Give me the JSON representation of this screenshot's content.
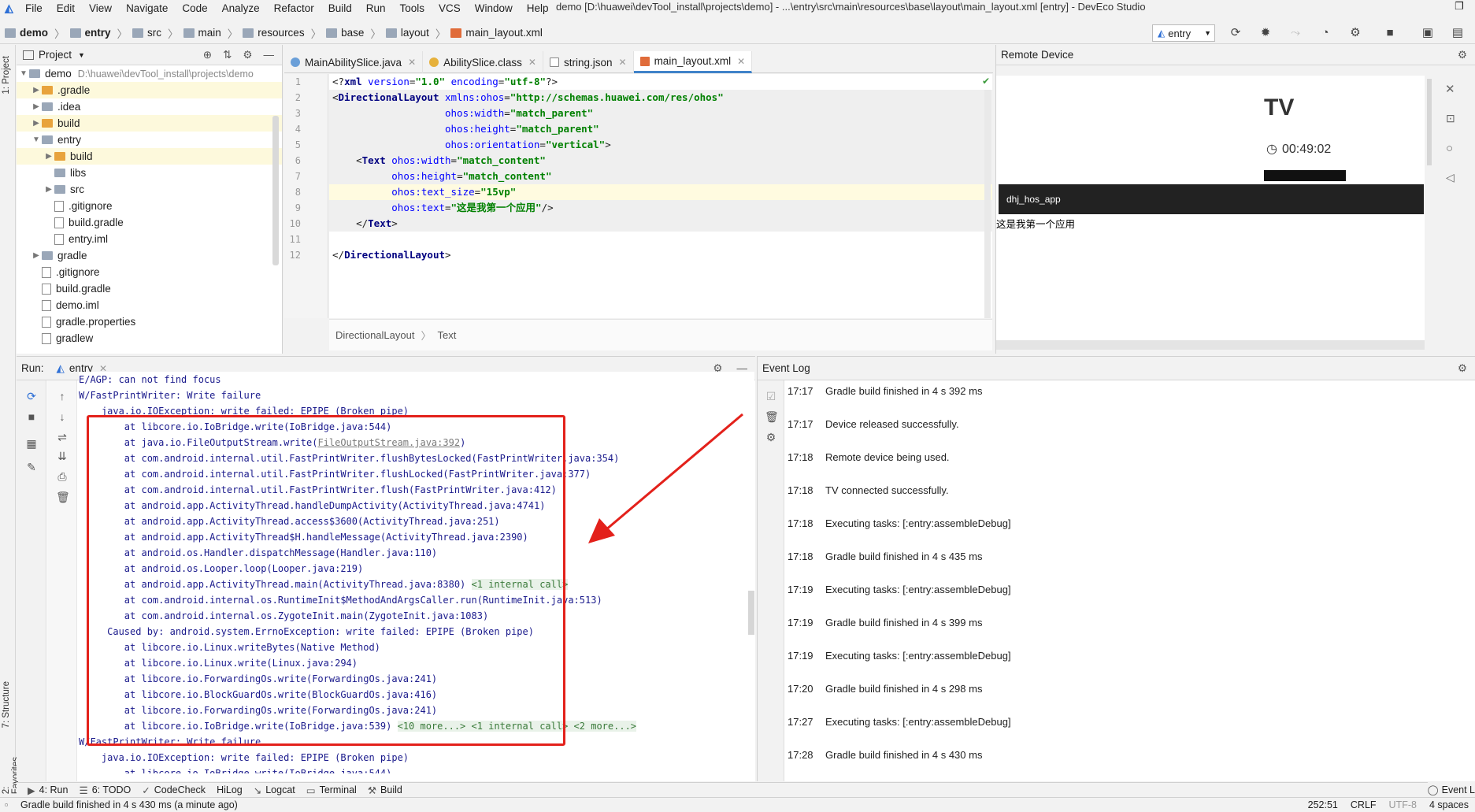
{
  "menu": {
    "items": [
      "File",
      "Edit",
      "View",
      "Navigate",
      "Code",
      "Analyze",
      "Refactor",
      "Build",
      "Run",
      "Tools",
      "VCS",
      "Window",
      "Help"
    ],
    "window_title": "demo [D:\\huawei\\devTool_install\\projects\\demo] - ...\\entry\\src\\main\\resources\\base\\layout\\main_layout.xml [entry] - DevEco Studio"
  },
  "breadcrumb": [
    "demo",
    "entry",
    "src",
    "main",
    "resources",
    "base",
    "layout",
    "main_layout.xml"
  ],
  "run_config": "entry",
  "project": {
    "title": "Project",
    "root": {
      "name": "demo",
      "path": "D:\\huawei\\devTool_install\\projects\\demo"
    },
    "items": [
      {
        "label": ".gradle",
        "depth": 1,
        "type": "folder",
        "expandable": true,
        "highlight": true
      },
      {
        "label": ".idea",
        "depth": 1,
        "type": "folder-grey",
        "expandable": true,
        "highlight": false
      },
      {
        "label": "build",
        "depth": 1,
        "type": "folder",
        "expandable": true,
        "highlight": true
      },
      {
        "label": "entry",
        "depth": 1,
        "type": "folder-grey",
        "expandable": true,
        "expanded": true,
        "highlight": false
      },
      {
        "label": "build",
        "depth": 2,
        "type": "folder",
        "expandable": true,
        "highlight": true
      },
      {
        "label": "libs",
        "depth": 2,
        "type": "folder-grey",
        "expandable": false,
        "highlight": false
      },
      {
        "label": "src",
        "depth": 2,
        "type": "folder-grey",
        "expandable": true,
        "highlight": false
      },
      {
        "label": ".gitignore",
        "depth": 2,
        "type": "file",
        "expandable": false,
        "highlight": false
      },
      {
        "label": "build.gradle",
        "depth": 2,
        "type": "file",
        "expandable": false,
        "highlight": false
      },
      {
        "label": "entry.iml",
        "depth": 2,
        "type": "file",
        "expandable": false,
        "highlight": false
      },
      {
        "label": "gradle",
        "depth": 1,
        "type": "folder-grey",
        "expandable": true,
        "highlight": false
      },
      {
        "label": ".gitignore",
        "depth": 1,
        "type": "file",
        "expandable": false,
        "highlight": false
      },
      {
        "label": "build.gradle",
        "depth": 1,
        "type": "file",
        "expandable": false,
        "highlight": false
      },
      {
        "label": "demo.iml",
        "depth": 1,
        "type": "file",
        "expandable": false,
        "highlight": false
      },
      {
        "label": "gradle.properties",
        "depth": 1,
        "type": "file",
        "expandable": false,
        "highlight": false
      },
      {
        "label": "gradlew",
        "depth": 1,
        "type": "file",
        "expandable": false,
        "highlight": false
      }
    ]
  },
  "editor": {
    "tabs": [
      {
        "label": "MainAbilitySlice.java",
        "active": false
      },
      {
        "label": "AbilitySlice.class",
        "active": false
      },
      {
        "label": "string.json",
        "active": false
      },
      {
        "label": "main_layout.xml",
        "active": true
      }
    ],
    "line_numbers": [
      "1",
      "2",
      "3",
      "4",
      "5",
      "6",
      "7",
      "8",
      "9",
      "10",
      "11",
      "12"
    ],
    "code_lines": [
      "<?xml version=\"1.0\" encoding=\"utf-8\"?>",
      "<DirectionalLayout xmlns:ohos=\"http://schemas.huawei.com/res/ohos\"",
      "                   ohos:width=\"match_parent\"",
      "                   ohos:height=\"match_parent\"",
      "                   ohos:orientation=\"vertical\">",
      "    <Text ohos:width=\"match_content\"",
      "          ohos:height=\"match_content\"",
      "          ohos:text_size=\"15vp\"",
      "          ohos:text=\"这是我第一个应用\"/>",
      "    </Text>",
      "",
      "</DirectionalLayout>"
    ],
    "breadcrumb": [
      "DirectionalLayout",
      "Text"
    ]
  },
  "remote_device": {
    "title": "Remote Device",
    "device_label": "TV",
    "clock": "00:49:02",
    "app_title": "dhj_hos_app",
    "app_text": "这是我第一个应用"
  },
  "run_panel": {
    "label": "Run:",
    "tab": "entry",
    "console_lines": [
      {
        "text": "E/AGP: can not find focus",
        "indent": 0
      },
      {
        "text": "W/FastPrintWriter: Write failure",
        "indent": 0
      },
      {
        "text": "    java.io.IOException: write failed: EPIPE (Broken pipe)",
        "indent": 0
      },
      {
        "text": "        at libcore.io.IoBridge.write(IoBridge.java:544)",
        "indent": 0
      },
      {
        "text": "        at java.io.FileOutputStream.write(",
        "link": "FileOutputStream.java:392",
        "tail": ")"
      },
      {
        "text": "        at com.android.internal.util.FastPrintWriter.flushBytesLocked(FastPrintWriter.java:354)",
        "indent": 0
      },
      {
        "text": "        at com.android.internal.util.FastPrintWriter.flushLocked(FastPrintWriter.java:377)",
        "indent": 0
      },
      {
        "text": "        at com.android.internal.util.FastPrintWriter.flush(FastPrintWriter.java:412)",
        "indent": 0
      },
      {
        "text": "        at android.app.ActivityThread.handleDumpActivity(ActivityThread.java:4741)",
        "indent": 0
      },
      {
        "text": "        at android.app.ActivityThread.access$3600(ActivityThread.java:251)",
        "indent": 0
      },
      {
        "text": "        at android.app.ActivityThread$H.handleMessage(ActivityThread.java:2390)",
        "indent": 0
      },
      {
        "text": "        at android.os.Handler.dispatchMessage(Handler.java:110)",
        "indent": 0
      },
      {
        "text": "        at android.os.Looper.loop(Looper.java:219)",
        "indent": 0
      },
      {
        "text": "        at android.app.ActivityThread.main(ActivityThread.java:8380) ",
        "fold": "<1 internal call>"
      },
      {
        "text": "        at com.android.internal.os.RuntimeInit$MethodAndArgsCaller.run(RuntimeInit.java:513)",
        "indent": 0
      },
      {
        "text": "        at com.android.internal.os.ZygoteInit.main(ZygoteInit.java:1083)",
        "indent": 0
      },
      {
        "text": "     Caused by: android.system.ErrnoException: write failed: EPIPE (Broken pipe)",
        "indent": 0
      },
      {
        "text": "        at libcore.io.Linux.writeBytes(Native Method)",
        "indent": 0
      },
      {
        "text": "        at libcore.io.Linux.write(Linux.java:294)",
        "indent": 0
      },
      {
        "text": "        at libcore.io.ForwardingOs.write(ForwardingOs.java:241)",
        "indent": 0
      },
      {
        "text": "        at libcore.io.BlockGuardOs.write(BlockGuardOs.java:416)",
        "indent": 0
      },
      {
        "text": "        at libcore.io.ForwardingOs.write(ForwardingOs.java:241)",
        "indent": 0
      },
      {
        "text": "        at libcore.io.IoBridge.write(IoBridge.java:539) ",
        "fold": "<10 more...> <1 internal call> <2 more...>"
      },
      {
        "text": "W/FastPrintWriter: Write failure",
        "indent": 0
      },
      {
        "text": "    java.io.IOException: write failed: EPIPE (Broken pipe)",
        "indent": 0
      },
      {
        "text": "        at libcore.io.IoBridge.write(IoBridge.java:544)",
        "indent": 0
      }
    ]
  },
  "event_log": {
    "title": "Event Log",
    "entries": [
      {
        "time": "17:17",
        "msg": "Gradle build finished in 4 s 392 ms"
      },
      {
        "time": "17:17",
        "msg": "Device released successfully."
      },
      {
        "time": "17:18",
        "msg": "Remote device being used."
      },
      {
        "time": "17:18",
        "msg": "TV connected successfully."
      },
      {
        "time": "17:18",
        "msg": "Executing tasks: [:entry:assembleDebug]"
      },
      {
        "time": "17:18",
        "msg": "Gradle build finished in 4 s 435 ms"
      },
      {
        "time": "17:19",
        "msg": "Executing tasks: [:entry:assembleDebug]"
      },
      {
        "time": "17:19",
        "msg": "Gradle build finished in 4 s 399 ms"
      },
      {
        "time": "17:19",
        "msg": "Executing tasks: [:entry:assembleDebug]"
      },
      {
        "time": "17:20",
        "msg": "Gradle build finished in 4 s 298 ms"
      },
      {
        "time": "17:27",
        "msg": "Executing tasks: [:entry:assembleDebug]"
      },
      {
        "time": "17:28",
        "msg": "Gradle build finished in 4 s 430 ms"
      }
    ]
  },
  "bottom_tabs": [
    {
      "label": "4: Run",
      "icon": "▶"
    },
    {
      "label": "6: TODO",
      "icon": "☰"
    },
    {
      "label": "CodeCheck",
      "icon": "✓"
    },
    {
      "label": "HiLog",
      "icon": ""
    },
    {
      "label": "Logcat",
      "icon": "↘"
    },
    {
      "label": "Terminal",
      "icon": "▭"
    },
    {
      "label": "Build",
      "icon": "⚒"
    }
  ],
  "bottom_right_tab": "Event L",
  "left_vertical_tabs": [
    "1: Project",
    "7: Structure",
    "2: Favorites"
  ],
  "status": {
    "message": "Gradle build finished in 4 s 430 ms (a minute ago)",
    "position": "252:51",
    "line_sep": "CRLF",
    "encoding": "UTF-8",
    "indent": "4 spaces"
  },
  "colors": {
    "accent": "#4083c9",
    "annotation_red": "#e3211b",
    "highlight_folder": "#e8a33c"
  }
}
